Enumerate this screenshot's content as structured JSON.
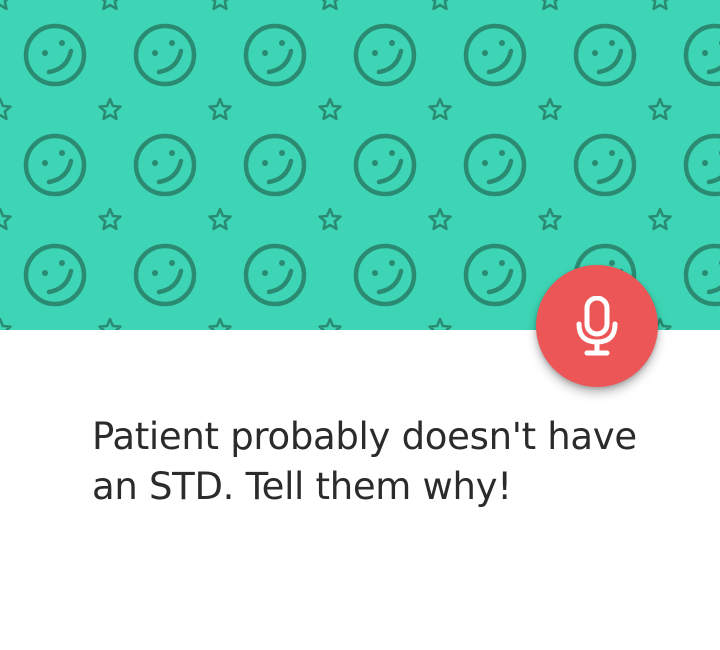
{
  "header": {
    "background_color": "#3dd5b5",
    "pattern_color": "#2a8b72",
    "pattern_icons": [
      "smiley-icon",
      "star-icon"
    ]
  },
  "mic_button": {
    "icon": "microphone-icon",
    "background_color": "#ec5656",
    "icon_color": "#ffffff"
  },
  "prompt": {
    "text": "Patient probably doesn't have an STD. Tell them why!"
  }
}
